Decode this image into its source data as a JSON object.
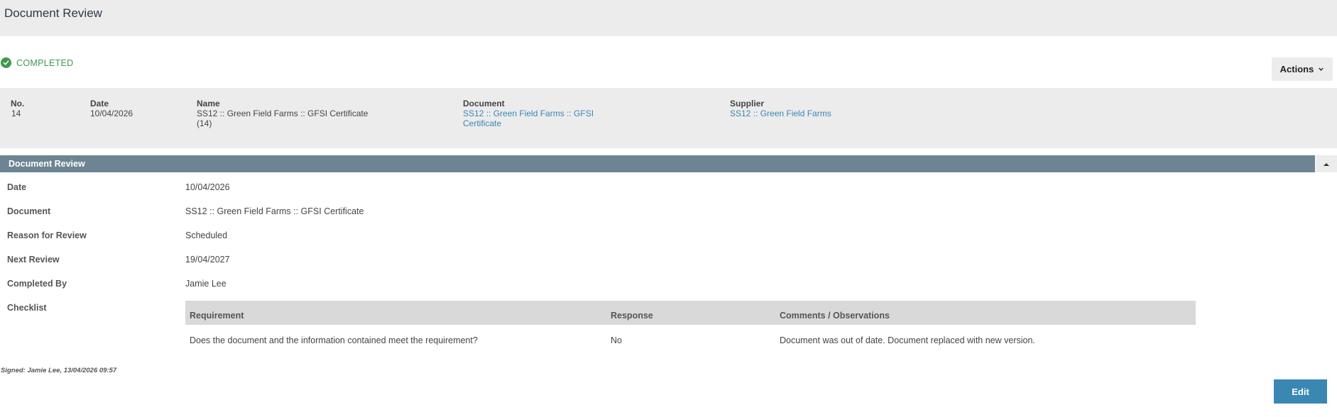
{
  "header": {
    "title": "Document Review"
  },
  "status": {
    "label": "COMPLETED",
    "color": "#3f9a4c"
  },
  "actions": {
    "label": "Actions"
  },
  "summary": {
    "no_label": "No.",
    "no_value": "14",
    "date_label": "Date",
    "date_value": "10/04/2026",
    "name_label": "Name",
    "name_value": "SS12 :: Green Field Farms :: GFSI Certificate",
    "name_value_2": "(14)",
    "document_label": "Document",
    "document_link": "SS12 :: Green Field Farms :: GFSI",
    "document_link_2": "Certificate",
    "supplier_label": "Supplier",
    "supplier_link": "SS12 :: Green Field Farms"
  },
  "section": {
    "title": "Document Review"
  },
  "fields": {
    "date_label": "Date",
    "date_value": "10/04/2026",
    "document_label": "Document",
    "document_value": "SS12 :: Green Field Farms :: GFSI Certificate",
    "reason_label": "Reason for Review",
    "reason_value": "Scheduled",
    "next_label": "Next Review",
    "next_value": "19/04/2027",
    "completed_label": "Completed By",
    "completed_value": "Jamie Lee",
    "checklist_label": "Checklist"
  },
  "checklist": {
    "headers": {
      "requirement": "Requirement",
      "response": "Response",
      "comments": "Comments / Observations"
    },
    "rows": [
      {
        "requirement": "Does the document and the information contained meet the requirement?",
        "response": "No",
        "comments": "Document was out of date. Document replaced with new version."
      }
    ]
  },
  "signed": "Signed: Jamie Lee, 13/04/2026 09:57",
  "edit": {
    "label": "Edit"
  },
  "colors": {
    "accent": "#3a87b3",
    "section_bar": "#6d8592",
    "panel": "#ececec"
  },
  "icons": {
    "status": "check-circle-icon",
    "actions": "chevron-down-icon",
    "collapse": "caret-up-icon"
  }
}
